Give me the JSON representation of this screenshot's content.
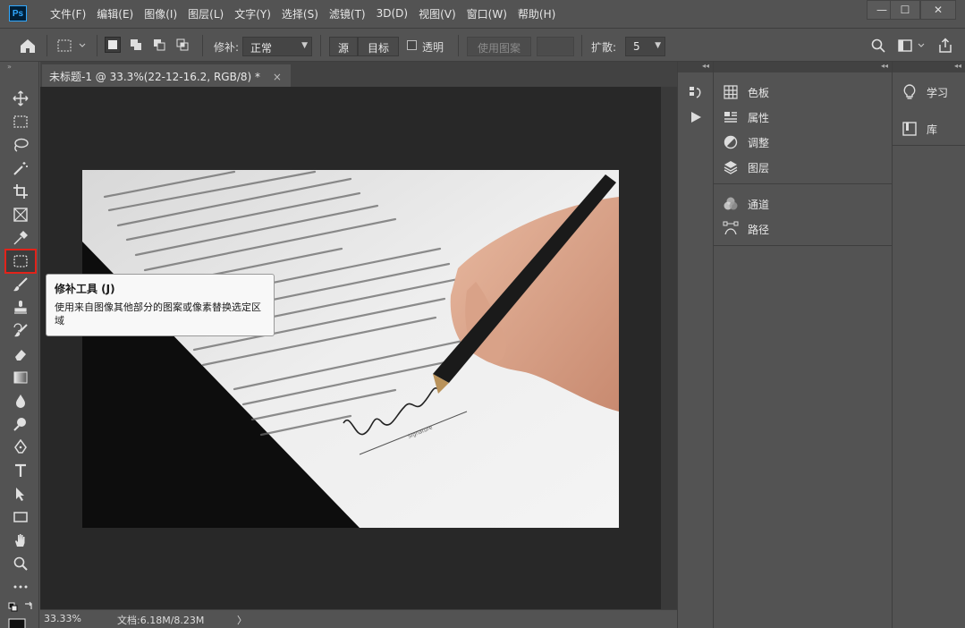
{
  "app": {
    "logo": "Ps"
  },
  "menu": [
    "文件(F)",
    "编辑(E)",
    "图像(I)",
    "图层(L)",
    "文字(Y)",
    "选择(S)",
    "滤镜(T)",
    "3D(D)",
    "视图(V)",
    "窗口(W)",
    "帮助(H)"
  ],
  "window_controls": {
    "minimize": "—",
    "maximize": "☐",
    "close": "✕"
  },
  "options": {
    "patch_label": "修补:",
    "patch_mode": "正常",
    "source_label": "源",
    "target_label": "目标",
    "transparent_label": "透明",
    "use_pattern_label": "使用图案",
    "diffuse_label": "扩散:",
    "diffuse_value": "5"
  },
  "document": {
    "tab_title": "未标题-1 @ 33.3%(22-12-16.2, RGB/8) *",
    "tab_close": "×"
  },
  "status": {
    "zoom": "33.33%",
    "doc_size": "文档:6.18M/8.23M",
    "arrow": "〉"
  },
  "tooltip": {
    "title": "修补工具 (J)",
    "description": "使用来自图像其他部分的图案或像素替换选定区域"
  },
  "panels": {
    "group1": [
      "色板",
      "属性",
      "调整",
      "图层"
    ],
    "group2": [
      "通道",
      "路径"
    ],
    "column2": [
      "学习",
      "库"
    ]
  },
  "image": {
    "signature_caption": "Signature"
  },
  "colors": {
    "selected_tool_outline": "#e2231a",
    "panel_bg": "#535353",
    "canvas_bg": "#282828"
  }
}
